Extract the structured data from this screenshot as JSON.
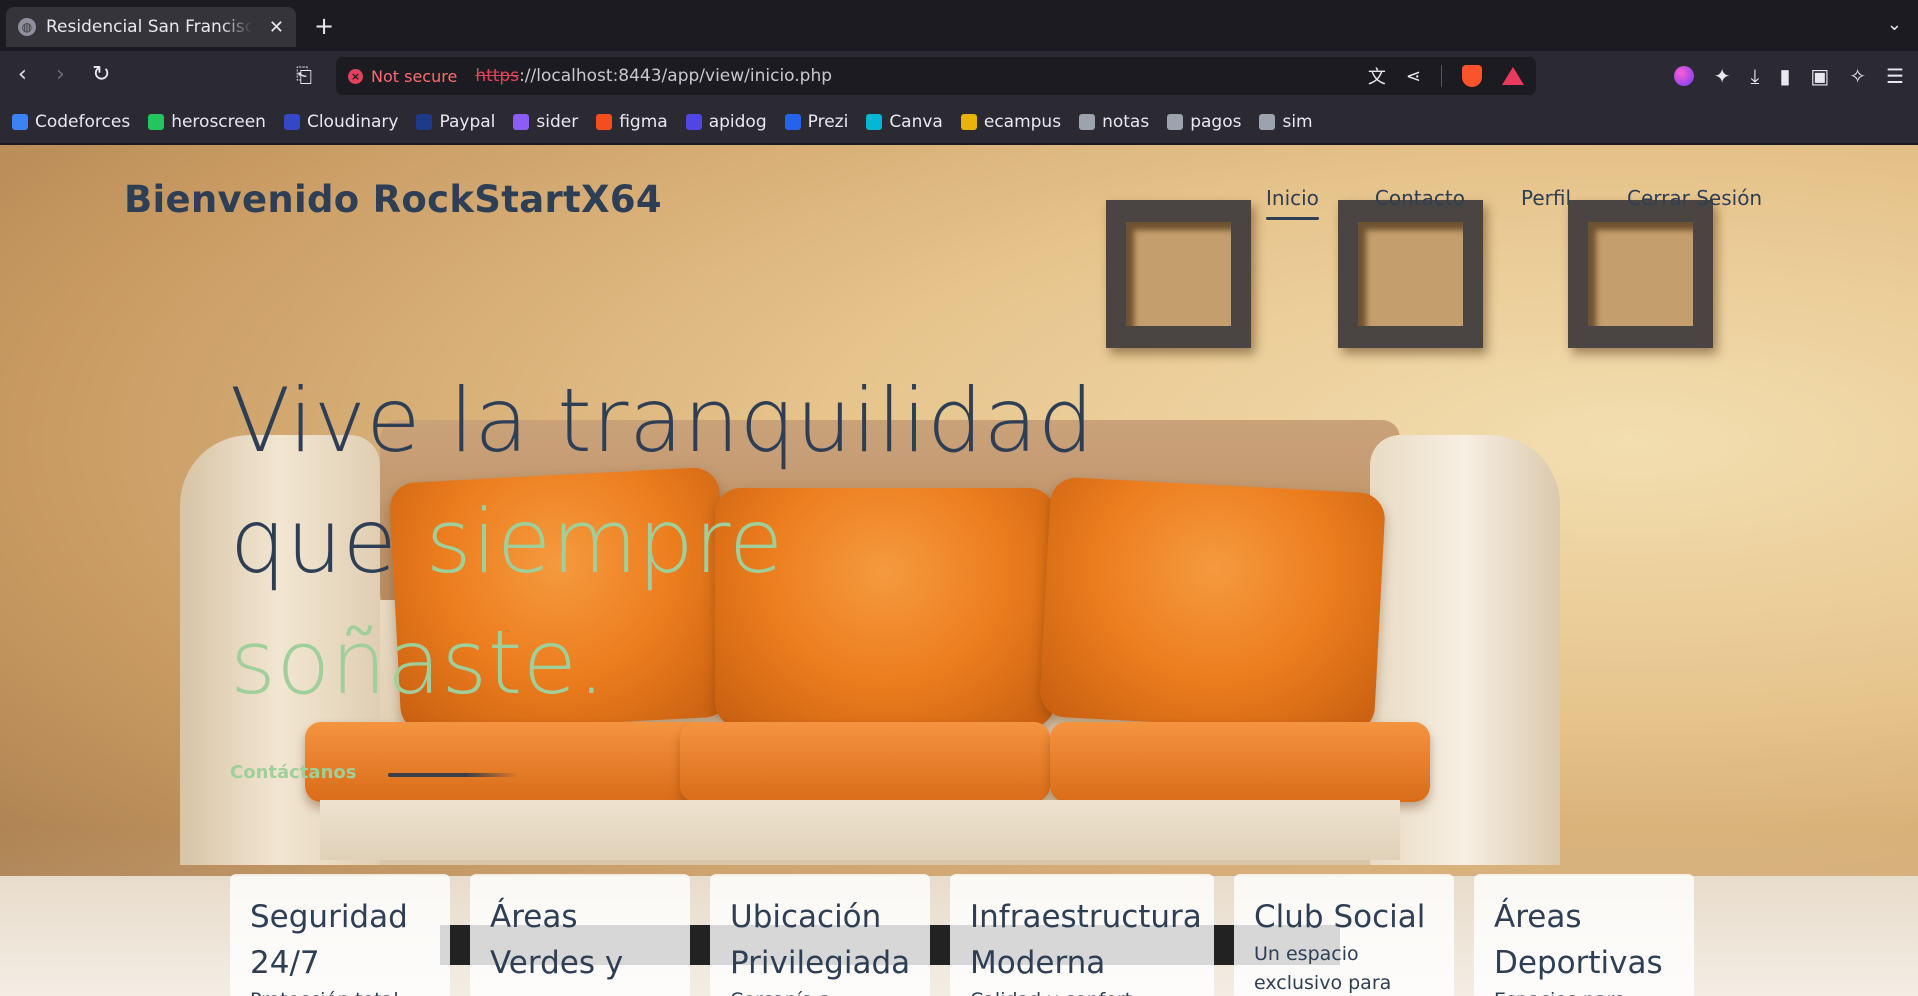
{
  "browser": {
    "tab_title": "Residencial San Francisco",
    "url_security": "Not secure",
    "url_scheme": "https",
    "url_rest": "://localhost:8443/app/view/inicio.php",
    "bookmarks": [
      {
        "label": "Codeforces",
        "color": "#3b82f6"
      },
      {
        "label": "heroscreen",
        "color": "#22c55e"
      },
      {
        "label": "Cloudinary",
        "color": "#3448c5"
      },
      {
        "label": "Paypal",
        "color": "#1e3a8a"
      },
      {
        "label": "sider",
        "color": "#8b5cf6"
      },
      {
        "label": "figma",
        "color": "#f24e1e"
      },
      {
        "label": "apidog",
        "color": "#4f46e5"
      },
      {
        "label": "Prezi",
        "color": "#2563eb"
      },
      {
        "label": "Canva",
        "color": "#06b6d4"
      },
      {
        "label": "ecampus",
        "color": "#eab308"
      },
      {
        "label": "notas",
        "color": "#9ca3af"
      },
      {
        "label": "pagos",
        "color": "#9ca3af"
      },
      {
        "label": "sim",
        "color": "#9ca3af"
      }
    ]
  },
  "site": {
    "brand": "Bienvenido RockStartX64",
    "nav": [
      {
        "label": "Inicio",
        "active": true
      },
      {
        "label": "Contacto",
        "active": false
      },
      {
        "label": "Perfil",
        "active": false
      },
      {
        "label": "Cerrar Sesión",
        "active": false
      }
    ],
    "hero": {
      "line1": "Vive la tranquilidad",
      "line2_plain": "que ",
      "line2_accent": "siempre",
      "line3_accent": "soñaste."
    },
    "cta_label": "Contáctanos",
    "colors": {
      "primary": "#2e3f55",
      "accent": "#9fcf9a"
    },
    "cards": [
      {
        "title": "Seguridad 24/7",
        "text": "Protección total"
      },
      {
        "title": "Áreas Verdes y",
        "text": ""
      },
      {
        "title": "Ubicación Privilegiada",
        "text": "Cercanía a"
      },
      {
        "title": "Infraestructura Moderna",
        "text": "Calidad y confort"
      },
      {
        "title": "Club Social",
        "text": "Un espacio exclusivo para"
      },
      {
        "title": "Áreas Deportivas",
        "text": "Espacios para"
      }
    ]
  }
}
